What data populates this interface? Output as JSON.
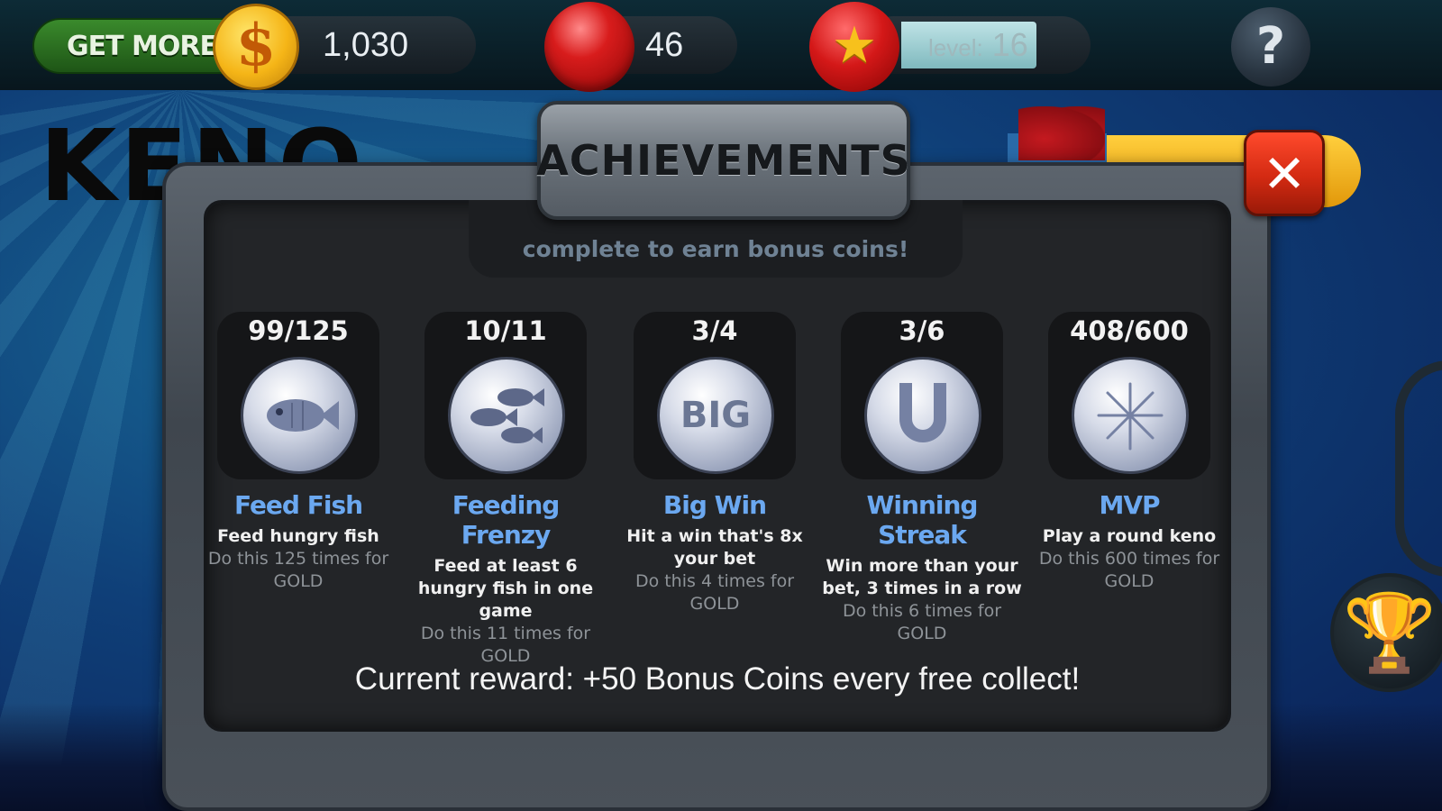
{
  "topbar": {
    "get_more_label": "GET MORE!",
    "coin_symbol": "$",
    "coins": "1,030",
    "balls": "46",
    "level_label": "level:",
    "level_value": "16",
    "help_symbol": "?"
  },
  "background": {
    "game_title": "KENO"
  },
  "dialog": {
    "title": "ACHIEVEMENTS",
    "subtitle": "complete to earn bonus coins!",
    "close_symbol": "✕",
    "achievements": [
      {
        "progress": "99/125",
        "icon": "fish-icon",
        "name": "Feed Fish",
        "description": "Feed hungry fish",
        "goal": "Do this 125 times for GOLD"
      },
      {
        "progress": "10/11",
        "icon": "school-of-fish-icon",
        "name": "Feeding Frenzy",
        "description": "Feed at least 6 hungry fish in one game",
        "goal": "Do this 11 times for GOLD"
      },
      {
        "progress": "3/4",
        "icon": "big-win-icon",
        "name": "Big Win",
        "description": "Hit a win that's 8x your bet",
        "goal": "Do this 4 times for GOLD",
        "medal_text": "BIG"
      },
      {
        "progress": "3/6",
        "icon": "horseshoe-icon",
        "name": "Winning Streak",
        "description": "Win more than your bet, 3 times in a row",
        "goal": "Do this 6 times for GOLD"
      },
      {
        "progress": "408/600",
        "icon": "fireworks-icon",
        "name": "MVP",
        "description": "Play a round keno",
        "goal": "Do this 600 times for GOLD"
      }
    ],
    "reward_text": "Current reward: +50 Bonus Coins every free collect!"
  },
  "colors": {
    "achievement_name": "#6ba8f0",
    "close_button": "#d32a12",
    "get_more": "#2e7a22"
  }
}
